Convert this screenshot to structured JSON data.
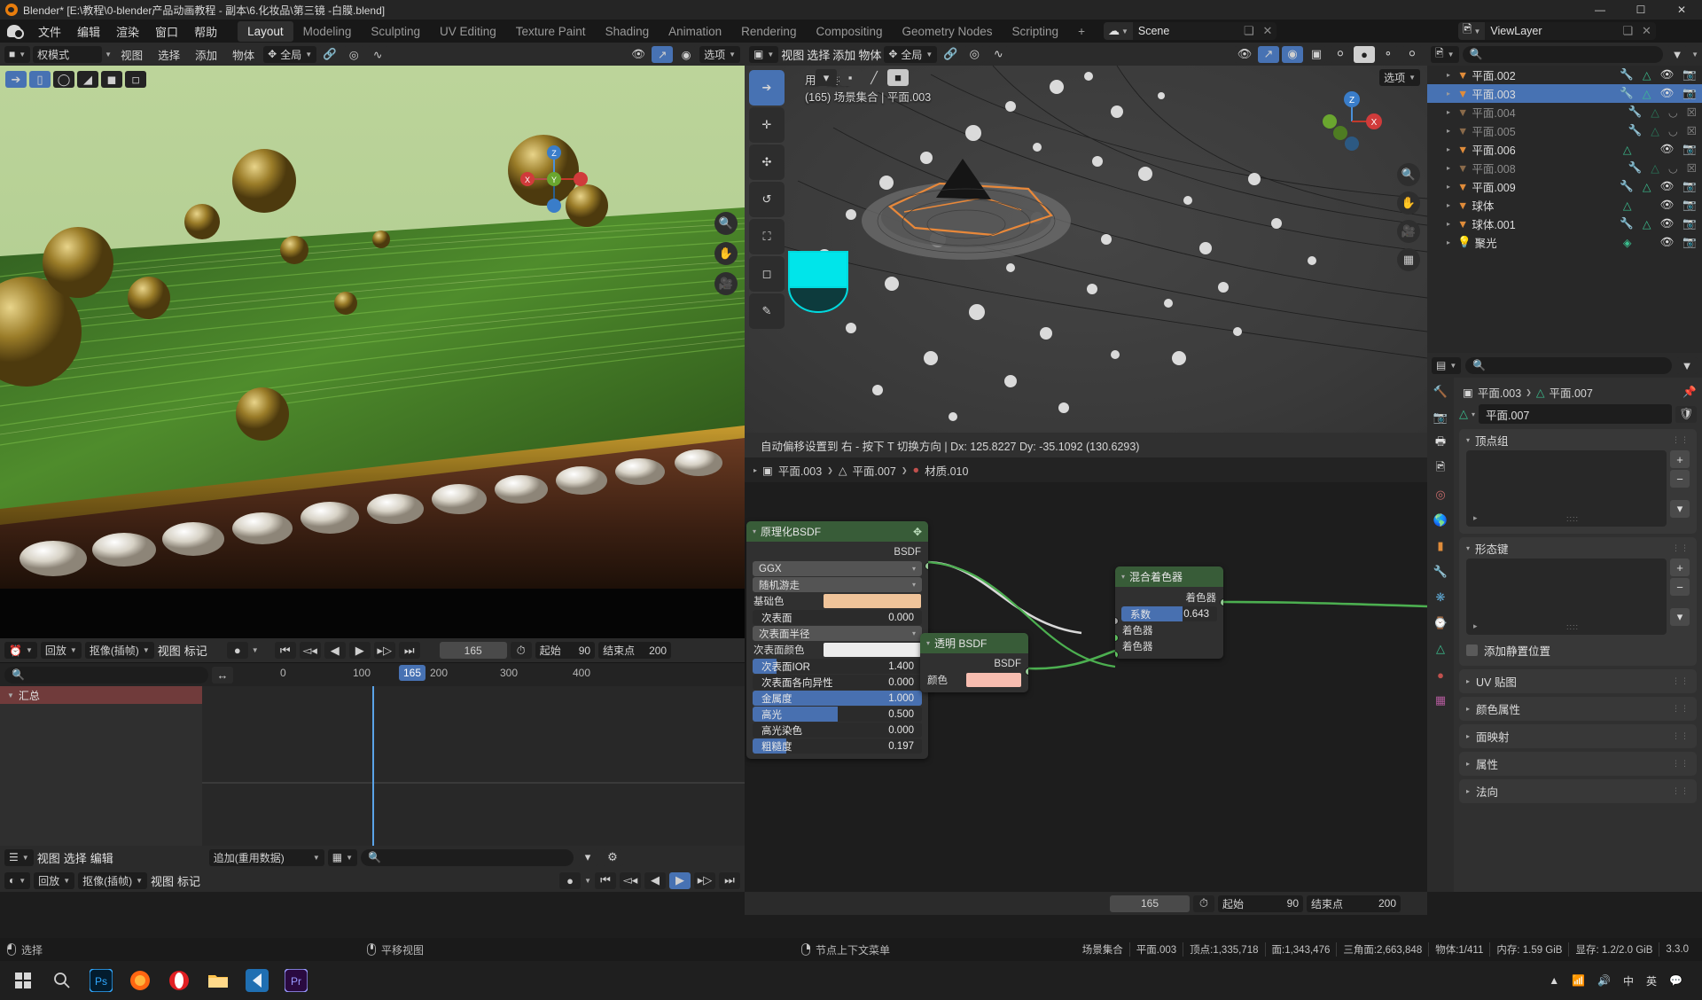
{
  "window": {
    "title": "Blender* [E:\\教程\\0-blender产品动画教程 - 副本\\6.化妆品\\第三镜 -白膜.blend]",
    "minimize": "—",
    "maximize": "☐",
    "close": "✕"
  },
  "topbar": {
    "menus": [
      "文件",
      "编辑",
      "渲染",
      "窗口",
      "帮助"
    ],
    "workspaces": [
      "Layout",
      "Modeling",
      "Sculpting",
      "UV Editing",
      "Texture Paint",
      "Shading",
      "Animation",
      "Rendering",
      "Compositing",
      "Geometry Nodes",
      "Scripting"
    ],
    "active_workspace": "Layout",
    "add_workspace": "+",
    "scene_name": "Scene",
    "viewlayer_name": "ViewLayer"
  },
  "image_editor": {
    "mode": "权模式",
    "menus": [
      "视图",
      "选择",
      "添加",
      "物体"
    ],
    "transform_orientation": "全局",
    "options_label": "选项"
  },
  "viewport": {
    "menus": [
      "视图",
      "选择",
      "添加",
      "物体"
    ],
    "transform_orientation": "全局",
    "options_label": "选项",
    "perspective_label": "用户透视",
    "scene_label": "(165) 场景集合 | 平面.003",
    "gizmo_axes": [
      "Z",
      "X",
      "Y"
    ],
    "status_line": "自动偏移设置到 右 - 按下 T 切换方向  |  Dx: 125.8227   Dy: -35.1092 (130.6293)"
  },
  "shader_editor": {
    "breadcrumb": [
      "平面.003",
      "平面.007",
      "材质.010"
    ],
    "nodes": [
      {
        "title": "原理化BSDF",
        "output_label": "BSDF",
        "distribution": "GGX",
        "subsurface_method": "随机游走",
        "base_color_label": "基础色",
        "base_color_hex": "#f0c49a",
        "rows": [
          {
            "label": "次表面",
            "value": "0.000",
            "fill": 0.0,
            "highlight": false
          },
          {
            "label": "次表面颜色",
            "value": "",
            "swatch": "#ececec"
          },
          {
            "label": "次表面IOR",
            "value": "1.400",
            "fill": 0.14,
            "highlight": true
          },
          {
            "label": "次表面各向异性",
            "value": "0.000",
            "fill": 0.0,
            "highlight": false
          },
          {
            "label": "金属度",
            "value": "1.000",
            "fill": 1.0,
            "highlight": true
          },
          {
            "label": "高光",
            "value": "0.500",
            "fill": 0.5,
            "highlight": true
          },
          {
            "label": "高光染色",
            "value": "0.000",
            "fill": 0.0,
            "highlight": false
          },
          {
            "label": "粗糙度",
            "value": "0.197",
            "fill": 0.197,
            "highlight": true
          }
        ],
        "subsurface_radius_label": "次表面半径"
      },
      {
        "title": "透明 BSDF",
        "output_label": "BSDF",
        "color_label": "颜色",
        "color_hex": "#f7bdb0"
      },
      {
        "title": "混合着色器",
        "output_label": "着色器",
        "factor_label": "系数",
        "factor_value": "0.643",
        "factor_fill": 0.643,
        "input_labels": [
          "着色器",
          "着色器"
        ]
      }
    ]
  },
  "dopesheet": {
    "editor_menus": [
      "回放",
      "抠像(插帧)",
      "视图",
      "标记"
    ],
    "playback_label": "回放",
    "keying_label": "抠像(插帧)",
    "current_frame": "165",
    "start_label": "起始",
    "start_value": "90",
    "end_label": "结束点",
    "end_value": "200",
    "ruler_ticks": [
      "0",
      "100",
      "165",
      "200",
      "300",
      "400"
    ],
    "summary_label": "汇总",
    "bottom_menus": [
      "视图",
      "选择",
      "编辑"
    ],
    "mode_label": "追加(重用数据)",
    "search_placeholder": ""
  },
  "outliner": {
    "search_placeholder": "",
    "items": [
      {
        "name": "平面.002",
        "selected": false,
        "dim": false,
        "visible": true,
        "modifier": true,
        "mesh": true
      },
      {
        "name": "平面.003",
        "selected": true,
        "dim": false,
        "visible": true,
        "modifier": true,
        "mesh": true
      },
      {
        "name": "平面.004",
        "selected": false,
        "dim": true,
        "visible": false,
        "modifier": true,
        "mesh": true
      },
      {
        "name": "平面.005",
        "selected": false,
        "dim": true,
        "visible": false,
        "modifier": true,
        "mesh": true
      },
      {
        "name": "平面.006",
        "selected": false,
        "dim": false,
        "visible": true,
        "modifier": false,
        "mesh": true
      },
      {
        "name": "平面.008",
        "selected": false,
        "dim": true,
        "visible": false,
        "modifier": true,
        "mesh": true
      },
      {
        "name": "平面.009",
        "selected": false,
        "dim": false,
        "visible": true,
        "modifier": true,
        "mesh": true
      },
      {
        "name": "球体",
        "selected": false,
        "dim": false,
        "visible": true,
        "modifier": false,
        "mesh": true
      },
      {
        "name": "球体.001",
        "selected": false,
        "dim": false,
        "visible": true,
        "modifier": true,
        "mesh": true
      },
      {
        "name": "聚光",
        "selected": false,
        "dim": false,
        "visible": true,
        "modifier": false,
        "mesh": false
      }
    ]
  },
  "properties": {
    "breadcrumb_object": "平面.003",
    "breadcrumb_data": "平面.007",
    "datablock_name": "平面.007",
    "open_panels": [
      {
        "title": "顶点组"
      },
      {
        "title": "形态键"
      }
    ],
    "shapekey_checkbox_label": "添加静置位置",
    "closed_panels": [
      "UV 贴图",
      "颜色属性",
      "面映射",
      "属性",
      "法向"
    ]
  },
  "timeline_bottom": {
    "current_frame": "165",
    "start_label": "起始",
    "start_value": "90",
    "end_label": "结束点",
    "end_value": "200"
  },
  "statusbar": {
    "hints": [
      {
        "mouse": "left",
        "label": "选择"
      },
      {
        "mouse": "middle",
        "label": "平移视图"
      },
      {
        "mouse": "right",
        "label": "节点上下文菜单"
      }
    ],
    "stats": [
      "场景集合",
      "平面.003",
      "顶点:1,335,718",
      "面:1,343,476",
      "三角面:2,663,848",
      "物体:1/411",
      "内存: 1.59 GiB",
      "显存: 1.2/2.0 GiB",
      "3.3.0"
    ]
  },
  "taskbar": {
    "apps": [
      "start",
      "search",
      "photoshop",
      "firefox",
      "opera",
      "explorer",
      "vscode",
      "premiere"
    ],
    "tray": [
      "^",
      "网络",
      "音量",
      "中",
      "英"
    ]
  },
  "colors": {
    "accent_blue": "#4772b3",
    "node_header_green": "#385c38",
    "selected_row": "#4772b3",
    "summary_row": "#703b3b",
    "playhead": "#5aa3e8"
  }
}
